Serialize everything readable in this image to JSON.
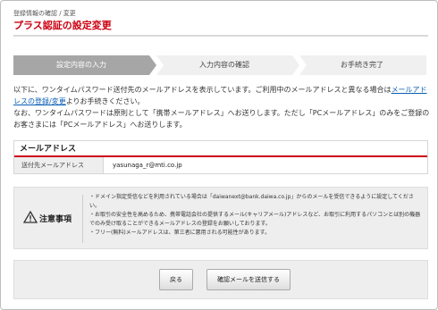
{
  "header": {
    "breadcrumb": "登録情報の確認 / 変更",
    "title": "プラス認証の設定変更"
  },
  "steps": [
    {
      "label": "設定内容の入力",
      "active": true
    },
    {
      "label": "入力内容の確認",
      "active": false
    },
    {
      "label": "お手続き完了",
      "active": false
    }
  ],
  "intro": {
    "line1": "以下に、ワンタイムパスワード送付先のメールアドレスを表示しています。ご利用中のメールアドレスと異なる場合は",
    "link": "メールアドレスの登録/変更",
    "line1b": "よりお手続きください。",
    "line2": "なお、ワンタイムパスワードは原則として「携帯メールアドレス」へお送りします。ただし「PCメールアドレス」のみをご登録のお客さまには「PCメールアドレス」へお送りします。"
  },
  "mail": {
    "title": "メールアドレス",
    "key": "送付先メールアドレス",
    "value": "yasunaga_r@mti.co.jp"
  },
  "notice": {
    "title": "注意事項",
    "items": [
      "・ドメイン指定受信などを利用されている場合は「daiwanext@bank.daiwa.co.jp」からのメールを受信できるように設定してください。",
      "・お取引の安全性を高めるため、携帯電話会社の提供するメール(キャリアメール)アドレスなど、お取引に利用するパソコンとは別の機器でのみ受け取ることができるメールアドレスの登録をお願いしております。",
      "・フリー(無料)メールアドレスは、第三者に悪用される可能性があります。"
    ]
  },
  "actions": {
    "back": "戻る",
    "confirm": "確認メールを送信する"
  },
  "colors": {
    "accent": "#cc0010",
    "step_active": "#a6a6a6",
    "step_inactive": "#f0f0f0",
    "link": "#0a5fb4"
  },
  "icons": {
    "notice": "warning-triangle-icon"
  }
}
